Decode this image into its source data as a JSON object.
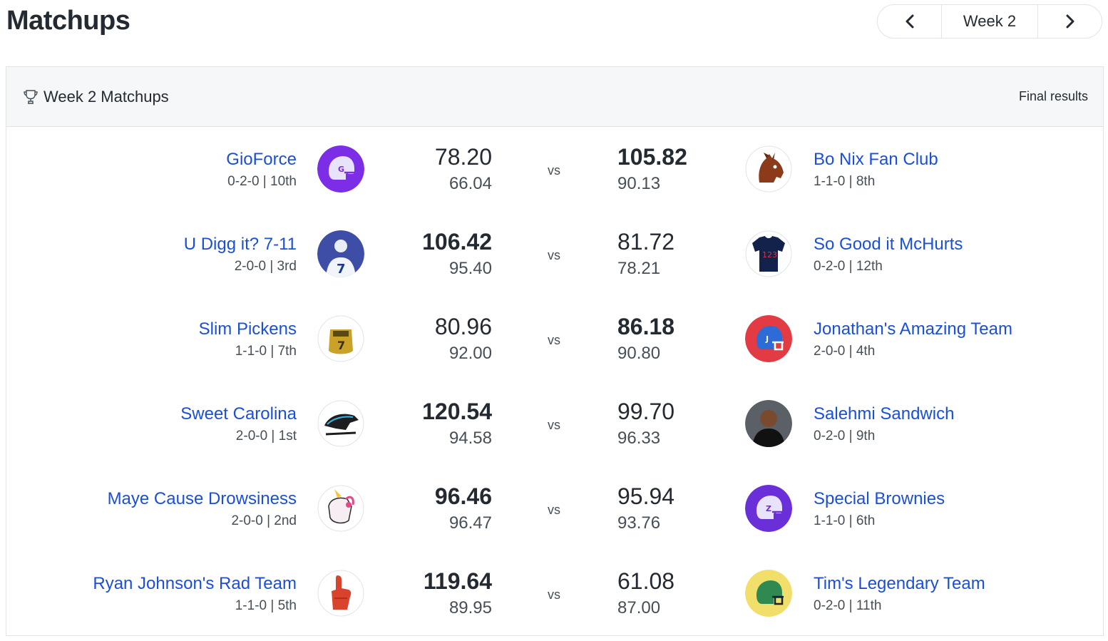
{
  "page": {
    "title": "Matchups"
  },
  "week_nav": {
    "prev_icon": "chevron-left-icon",
    "label": "Week 2",
    "next_icon": "chevron-right-icon"
  },
  "card": {
    "title": "Week 2 Matchups",
    "title_icon": "trophy-icon",
    "status": "Final results"
  },
  "vs_label": "vs",
  "matchups": [
    {
      "home": {
        "name": "GioForce",
        "record": "0-2-0 | 10th",
        "score": "78.20",
        "projected": "66.04",
        "logo": "purple-helmet-g"
      },
      "away": {
        "name": "Bo Nix Fan Club",
        "record": "1-1-0 | 8th",
        "score": "105.82",
        "projected": "90.13",
        "logo": "bronco-horse"
      },
      "winner": "away"
    },
    {
      "home": {
        "name": "U Digg it? 7-11",
        "record": "2-0-0 | 3rd",
        "score": "106.42",
        "projected": "95.40",
        "logo": "player-photo-7"
      },
      "away": {
        "name": "So Good it McHurts",
        "record": "0-2-0 | 12th",
        "score": "81.72",
        "projected": "78.21",
        "logo": "jersey-123"
      },
      "winner": "home"
    },
    {
      "home": {
        "name": "Slim Pickens",
        "record": "1-1-0 | 7th",
        "score": "80.96",
        "projected": "92.00",
        "logo": "gold-ring"
      },
      "away": {
        "name": "Jonathan's Amazing Team",
        "record": "2-0-0 | 4th",
        "score": "86.18",
        "projected": "90.80",
        "logo": "red-helmet-j"
      },
      "winner": "away"
    },
    {
      "home": {
        "name": "Sweet Carolina",
        "record": "2-0-0 | 1st",
        "score": "120.54",
        "projected": "94.58",
        "logo": "panther"
      },
      "away": {
        "name": "Salehmi Sandwich",
        "record": "0-2-0 | 9th",
        "score": "99.70",
        "projected": "96.33",
        "logo": "person-photo"
      },
      "winner": "home"
    },
    {
      "home": {
        "name": "Maye Cause Drowsiness",
        "record": "2-0-0 | 2nd",
        "score": "96.46",
        "projected": "96.47",
        "logo": "unicorn"
      },
      "away": {
        "name": "Special Brownies",
        "record": "1-1-0 | 6th",
        "score": "95.94",
        "projected": "93.76",
        "logo": "purple-helmet-z"
      },
      "winner": "home"
    },
    {
      "home": {
        "name": "Ryan Johnson's Rad Team",
        "record": "1-1-0 | 5th",
        "score": "119.64",
        "projected": "89.95",
        "logo": "foam-finger"
      },
      "away": {
        "name": "Tim's Legendary Team",
        "record": "0-2-0 | 11th",
        "score": "61.08",
        "projected": "87.00",
        "logo": "yellow-helmet"
      },
      "winner": "home"
    }
  ],
  "colors": {
    "link": "#1a4fd6",
    "text": "#232a31",
    "muted": "#464e56",
    "border": "#e0e4e9",
    "header_bg": "#f5f7f9"
  }
}
